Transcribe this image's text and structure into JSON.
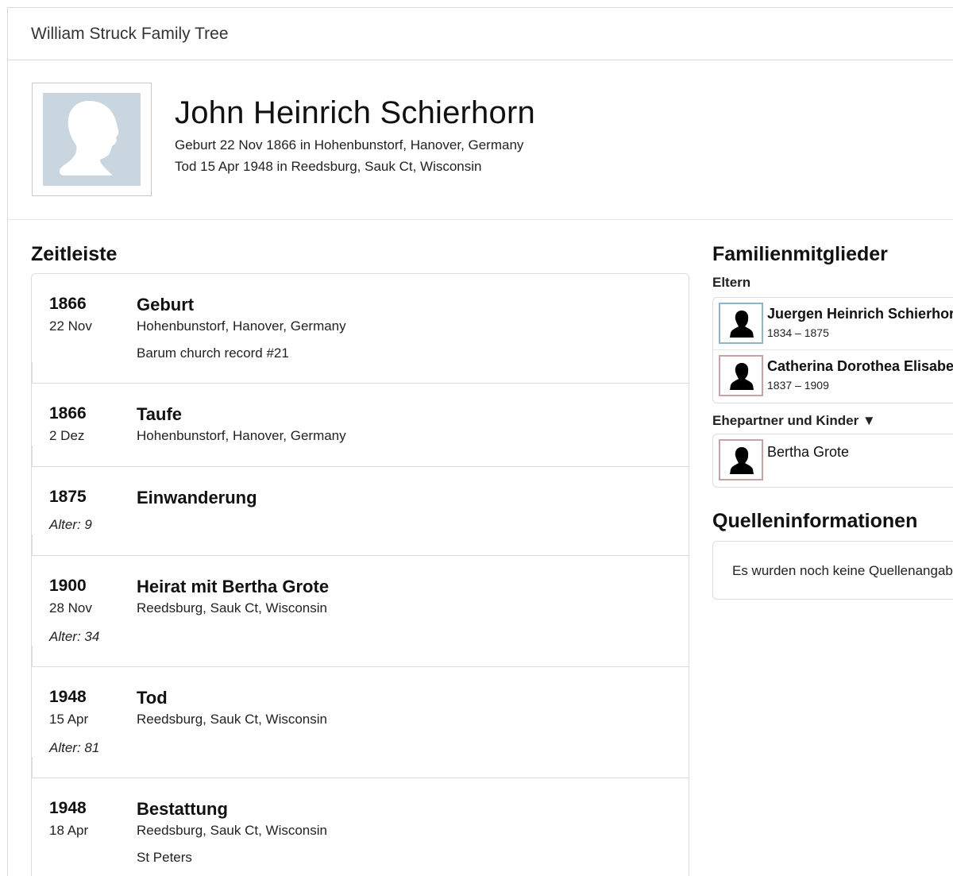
{
  "app": {
    "title": "William Struck Family Tree"
  },
  "person": {
    "name": "John Heinrich Schierhorn",
    "birth": "Geburt 22 Nov 1866 in Hohenbunstorf, Hanover, Germany",
    "death": "Tod 15 Apr 1948 in Reedsburg, Sauk Ct, Wisconsin"
  },
  "timeline": {
    "title": "Zeitleiste",
    "events": [
      {
        "year": "1866",
        "date": "22 Nov",
        "title": "Geburt",
        "place": "Hohenbunstorf, Hanover, Germany",
        "note": "Barum church record #21",
        "age": ""
      },
      {
        "year": "1866",
        "date": "2 Dez",
        "title": "Taufe",
        "place": "Hohenbunstorf, Hanover, Germany",
        "note": "",
        "age": ""
      },
      {
        "year": "1875",
        "date": "",
        "title": "Einwanderung",
        "place": "",
        "note": "",
        "age": "Alter: 9"
      },
      {
        "year": "1900",
        "date": "28 Nov",
        "title": "Heirat mit Bertha Grote",
        "place": "Reedsburg, Sauk Ct, Wisconsin",
        "note": "",
        "age": "Alter: 34"
      },
      {
        "year": "1948",
        "date": "15 Apr",
        "title": "Tod",
        "place": "Reedsburg, Sauk Ct, Wisconsin",
        "note": "",
        "age": "Alter: 81"
      },
      {
        "year": "1948",
        "date": "18 Apr",
        "title": "Bestattung",
        "place": "Reedsburg, Sauk Ct, Wisconsin",
        "note": "St Peters",
        "age": ""
      }
    ]
  },
  "family": {
    "title": "Familienmitglieder",
    "parents_label": "Eltern",
    "parents": [
      {
        "name": "Juergen Heinrich Schierhorn",
        "dates": "1834 – 1875",
        "gender": "male"
      },
      {
        "name": "Catherina Dorothea Elisabeth",
        "dates": "1837 – 1909",
        "gender": "female"
      }
    ],
    "spouses_label": "Ehepartner und Kinder ▼",
    "spouses": [
      {
        "name": "Bertha Grote",
        "dates": "",
        "gender": "female"
      }
    ]
  },
  "sources": {
    "title": "Quelleninformationen",
    "text": "Es wurden noch keine Quellenangaben hinzugefügt."
  },
  "colors": {
    "male_border": "#8fb3c9",
    "female_border": "#c7a2a2",
    "placeholder_photo": "#c9d6df"
  }
}
